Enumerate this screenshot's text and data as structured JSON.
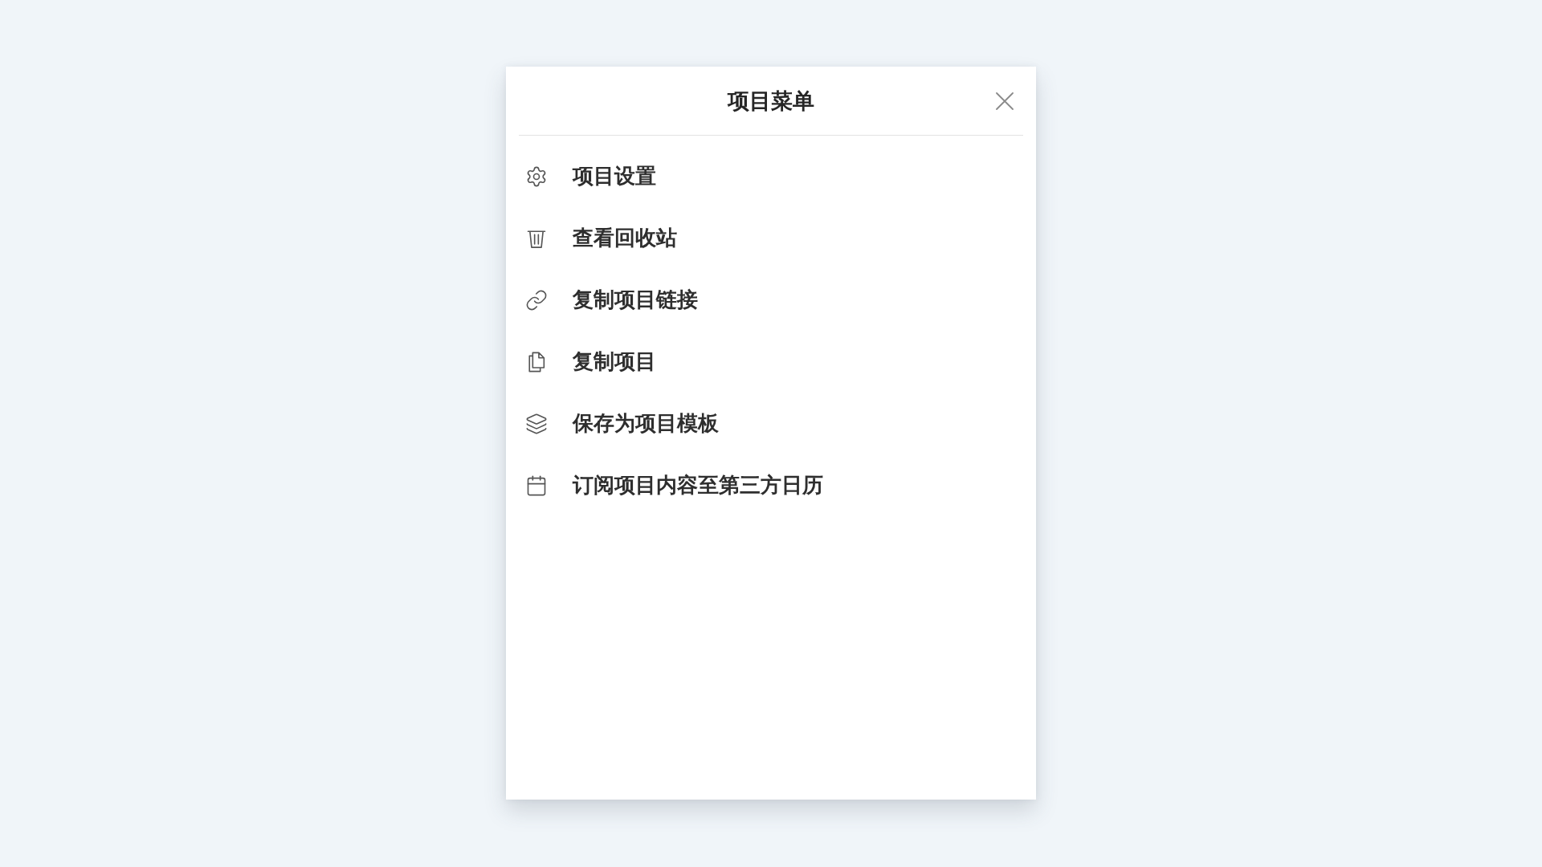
{
  "dialog": {
    "title": "项目菜单",
    "menu_items": [
      {
        "label": "项目设置"
      },
      {
        "label": "查看回收站"
      },
      {
        "label": "复制项目链接"
      },
      {
        "label": "复制项目"
      },
      {
        "label": "保存为项目模板"
      },
      {
        "label": "订阅项目内容至第三方日历"
      }
    ]
  }
}
